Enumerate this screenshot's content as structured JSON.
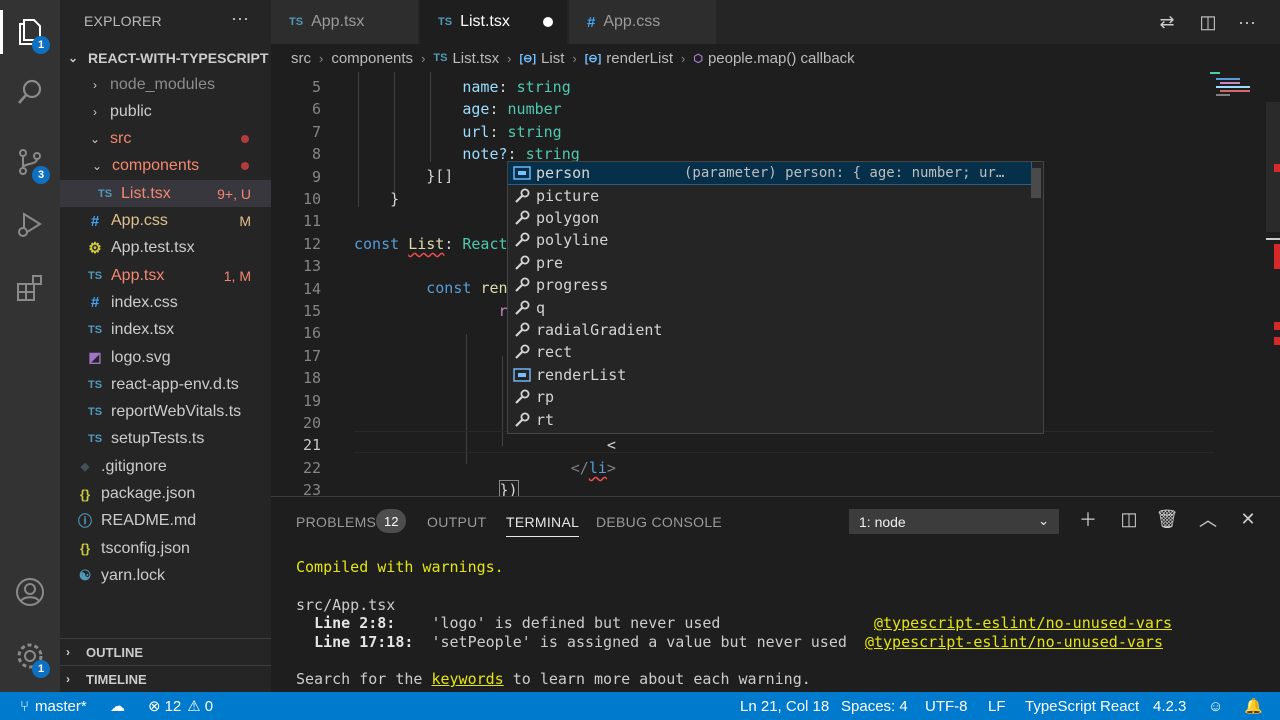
{
  "activity": {
    "explorer_badge": "1",
    "scm_badge": "3",
    "settings_badge": "1"
  },
  "sidebar": {
    "title": "EXPLORER",
    "more": "···",
    "project": "REACT-WITH-TYPESCRIPT",
    "items": [
      {
        "label": "node_modules",
        "icon": ">",
        "color": "#8c8c8c"
      },
      {
        "label": "public",
        "icon": ">",
        "color": "#cccccc"
      },
      {
        "label": "src",
        "icon": "v",
        "color": "#f48771"
      },
      {
        "label": "components",
        "icon": "v",
        "color": "#f48771"
      },
      {
        "label": "List.tsx",
        "icon": "TS",
        "color": "#f48771",
        "deco": "9+, U"
      },
      {
        "label": "App.css",
        "icon": "#",
        "color": "#e2c08d",
        "deco": "M"
      },
      {
        "label": "App.test.tsx",
        "icon": "gear",
        "color": "#cccccc"
      },
      {
        "label": "App.tsx",
        "icon": "TS",
        "color": "#f48771",
        "deco": "1, M"
      },
      {
        "label": "index.css",
        "icon": "#",
        "color": "#cccccc"
      },
      {
        "label": "index.tsx",
        "icon": "TS",
        "color": "#cccccc"
      },
      {
        "label": "logo.svg",
        "icon": "svg",
        "color": "#cccccc"
      },
      {
        "label": "react-app-env.d.ts",
        "icon": "TS",
        "color": "#cccccc"
      },
      {
        "label": "reportWebVitals.ts",
        "icon": "TS",
        "color": "#cccccc"
      },
      {
        "label": "setupTests.ts",
        "icon": "TS",
        "color": "#cccccc"
      },
      {
        "label": ".gitignore",
        "icon": "git",
        "color": "#cccccc"
      },
      {
        "label": "package.json",
        "icon": "{}",
        "color": "#cccccc"
      },
      {
        "label": "README.md",
        "icon": "i",
        "color": "#cccccc"
      },
      {
        "label": "tsconfig.json",
        "icon": "{}",
        "color": "#cccccc"
      },
      {
        "label": "yarn.lock",
        "icon": "yarn",
        "color": "#cccccc"
      }
    ],
    "outline": "OUTLINE",
    "timeline": "TIMELINE"
  },
  "tabs": [
    {
      "label": "App.tsx",
      "icon": "TS"
    },
    {
      "label": "List.tsx",
      "icon": "TS"
    },
    {
      "label": "App.css",
      "icon": "#"
    }
  ],
  "breadcrumb": [
    "src",
    "components",
    "List.tsx",
    "List",
    "renderList",
    "people.map() callback"
  ],
  "editor": {
    "line_numbers": [
      "5",
      "6",
      "7",
      "8",
      "9",
      "10",
      "11",
      "12",
      "13",
      "14",
      "15",
      "16",
      "17",
      "18",
      "19",
      "20",
      "21",
      "22",
      "23"
    ],
    "lines": {
      "l5": {
        "prop": "name",
        "type": "string"
      },
      "l6": {
        "prop": "age",
        "type": "number"
      },
      "l7": {
        "prop": "url",
        "type": "string"
      },
      "l8": {
        "prop": "note?",
        "type": "string"
      },
      "l9": "}[]",
      "l10": "}",
      "l12": {
        "kw": "const",
        "name": "List",
        "type": "React"
      },
      "l14": {
        "kw": "const",
        "name": "renderL"
      },
      "l15": {
        "kw": "return",
        "rest": "pe"
      },
      "l16": {
        "open": "<",
        "tag": "li",
        "rest": "c"
      },
      "l17": "<",
      "l20": "<",
      "l21": "<",
      "l22": {
        "tag": "li"
      },
      "l23": "})"
    }
  },
  "suggest": {
    "items": [
      {
        "label": "person",
        "icon": "variable"
      },
      {
        "label": "picture",
        "icon": "wrench"
      },
      {
        "label": "polygon",
        "icon": "wrench"
      },
      {
        "label": "polyline",
        "icon": "wrench"
      },
      {
        "label": "pre",
        "icon": "wrench"
      },
      {
        "label": "progress",
        "icon": "wrench"
      },
      {
        "label": "q",
        "icon": "wrench"
      },
      {
        "label": "radialGradient",
        "icon": "wrench"
      },
      {
        "label": "rect",
        "icon": "wrench"
      },
      {
        "label": "renderList",
        "icon": "variable"
      },
      {
        "label": "rp",
        "icon": "wrench"
      },
      {
        "label": "rt",
        "icon": "wrench"
      }
    ],
    "detail": "(parameter) person: { age: number; ur…"
  },
  "panel": {
    "tabs": [
      "PROBLEMS",
      "OUTPUT",
      "TERMINAL",
      "DEBUG CONSOLE"
    ],
    "problems_count": "12",
    "terminal_select": "1: node",
    "terminal": {
      "compiled": "Compiled with warnings.",
      "file": "src/App.tsx",
      "w1_loc": "Line 2:8:",
      "w1_msg": "'logo' is defined but never used",
      "w1_rule": "@typescript-eslint/no-unused-vars",
      "w2_loc": "Line 17:18:",
      "w2_msg": "'setPeople' is assigned a value but never used",
      "w2_rule": "@typescript-eslint/no-unused-vars",
      "hint_pre": "Search for the",
      "hint_kw": "keywords",
      "hint_post": "to learn more about each warning."
    }
  },
  "status": {
    "branch": "master*",
    "errors": "12",
    "warnings": "0",
    "position": "Ln 21, Col 18",
    "spaces": "Spaces: 4",
    "encoding": "UTF-8",
    "eol": "LF",
    "language": "TypeScript React",
    "version": "4.2.3"
  },
  "colors": {
    "accent": "#007acc",
    "error": "#f48771",
    "modified": "#e2c08d"
  }
}
